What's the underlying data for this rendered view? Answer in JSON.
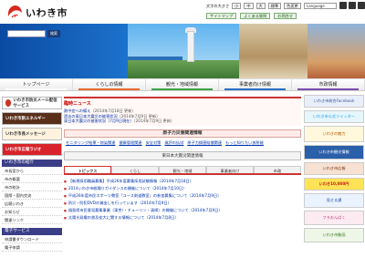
{
  "header": {
    "logo_text": "いわき市",
    "top_links": [
      "文字の大きさ",
      "小",
      "中",
      "大",
      "標準",
      "色変更"
    ],
    "lang_selected": "Language",
    "top_links_2": [
      "サイトマップ",
      "よくある質問",
      "お問合せ"
    ]
  },
  "hero": {
    "site_name": "Iwaki City Official Web Site",
    "search_button": "検索"
  },
  "nav": {
    "items": [
      {
        "label": "トップページ",
        "color": "#ffffff"
      },
      {
        "label": "くらしの情報",
        "color": "#e96a2f"
      },
      {
        "label": "観光・地域情報",
        "color": "#3fa44a"
      },
      {
        "label": "事業者向け情報",
        "color": "#2d6fc6"
      },
      {
        "label": "市政情報",
        "color": "#7b4fb0"
      }
    ]
  },
  "left": {
    "banners": [
      "いわき市防災メール配信サービス",
      "いわき市新エネルギー",
      "いわき市長メッセージ",
      "いわき市広報ラジオ"
    ],
    "section1_title": "いわき市の紹介",
    "section1_items": [
      "市長室から",
      "市の概要",
      "市の統計",
      "国際・国内交流",
      "広聴いわき",
      "お知らせ",
      "関連リンク"
    ],
    "section2_title": "電子サービス",
    "section2_items": [
      "申請書ダウンロード",
      "電子申請"
    ]
  },
  "main": {
    "notice_title": "臨時ニュース",
    "notices": [
      {
        "text": "熱中症への備え",
        "date": "（2014年7月18日 更新）"
      },
      {
        "text": "過去の東日本大震災の被害状況",
        "date": "（2014年7月9日 更新）"
      },
      {
        "text": "東日本大震災の被害状況（7月9日現在）",
        "date": "（2014年7月9日 更新）"
      }
    ],
    "nuclear_title": "原子力災害関連情報",
    "nuclear_links": [
      "モニタリング結果・除染関連",
      "健康管理関連",
      "安全対策",
      "風評の払拭",
      "原子力損害賠償関連",
      "もっと知りたい放射能"
    ],
    "tsunami_title": "東日本大震災関連情報",
    "tabs": [
      "トピックス",
      "くらし",
      "観光・地域",
      "事業者向け",
      "市政"
    ],
    "topics": [
      "【新規採用職員募集】平成26年度募集採用試験情報（2014年7月18日）",
      "2014いわき市総踊りガイダンスの開催について（2014年7月10日）",
      "平成26年度市民スポーツ教室「ユース剣道教室」の参加募集について（2014年7月9日）",
      "防災・防犯DVDの貸出しを行っています（2014年7月9日）",
      "福島県市民意見募集事業（東京）・チューリン・清掃）の開催について（2014年7月9日）",
      "太陽光発電の普及拡大に関する情報について（2014年7月8日）"
    ]
  },
  "right": {
    "banners": [
      "いわき市総合Facebook",
      "いわき市公式ツイッター",
      "いわきの魅力",
      "いわき市観光情報",
      "いわき市広報",
      "いわき10,000円",
      "見せる課",
      "フラおんぱく",
      "いわき市動画"
    ]
  }
}
